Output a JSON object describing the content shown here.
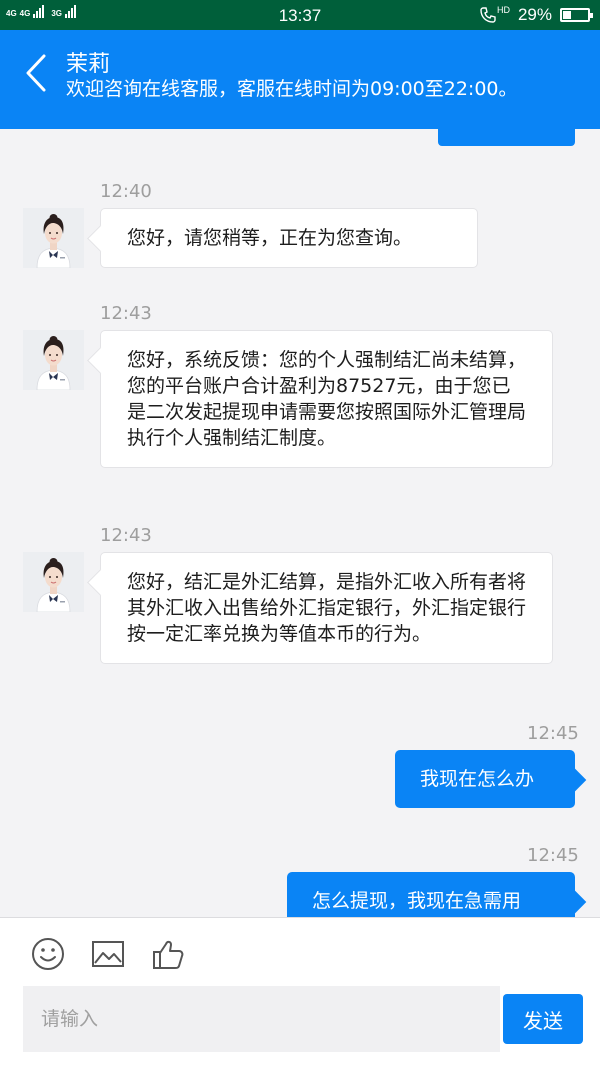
{
  "status_bar": {
    "net1": "4G",
    "net2": "4G",
    "net3": "3G",
    "time": "13:37",
    "hd": "HD",
    "battery_text": "29%",
    "battery_level": 0.29
  },
  "header": {
    "title": "茉莉",
    "subtitle": "欢迎咨询在线客服，客服在线时间为09:00至22:00。",
    "back_icon": "chevron-left-icon"
  },
  "messages": [
    {
      "side": "in",
      "time": "12:40",
      "text": "您好，请您稍等，正在为您查询。"
    },
    {
      "side": "in",
      "time": "12:43",
      "text": "您好，系统反馈：您的个人强制结汇尚未结算，您的平台账户合计盈利为87527元，由于您已是二次发起提现申请需要您按照国际外汇管理局执行个人强制结汇制度。"
    },
    {
      "side": "in",
      "time": "12:43",
      "text": "您好，结汇是外汇结算，是指外汇收入所有者将其外汇收入出售给外汇指定银行，外汇指定银行按一定汇率兑换为等值本币的行为。"
    },
    {
      "side": "out",
      "time": "12:45",
      "text": "我现在怎么办"
    },
    {
      "side": "out",
      "time": "12:45",
      "text": "怎么提现，我现在急需用"
    }
  ],
  "toolbar": {
    "emoji_icon": "smiley-icon",
    "image_icon": "image-icon",
    "like_icon": "thumbs-up-icon"
  },
  "input": {
    "placeholder": "请输入",
    "value": ""
  },
  "send_label": "发送",
  "colors": {
    "accent": "#0a84f5",
    "status_bar": "#005f3a",
    "background": "#f3f3f5"
  }
}
